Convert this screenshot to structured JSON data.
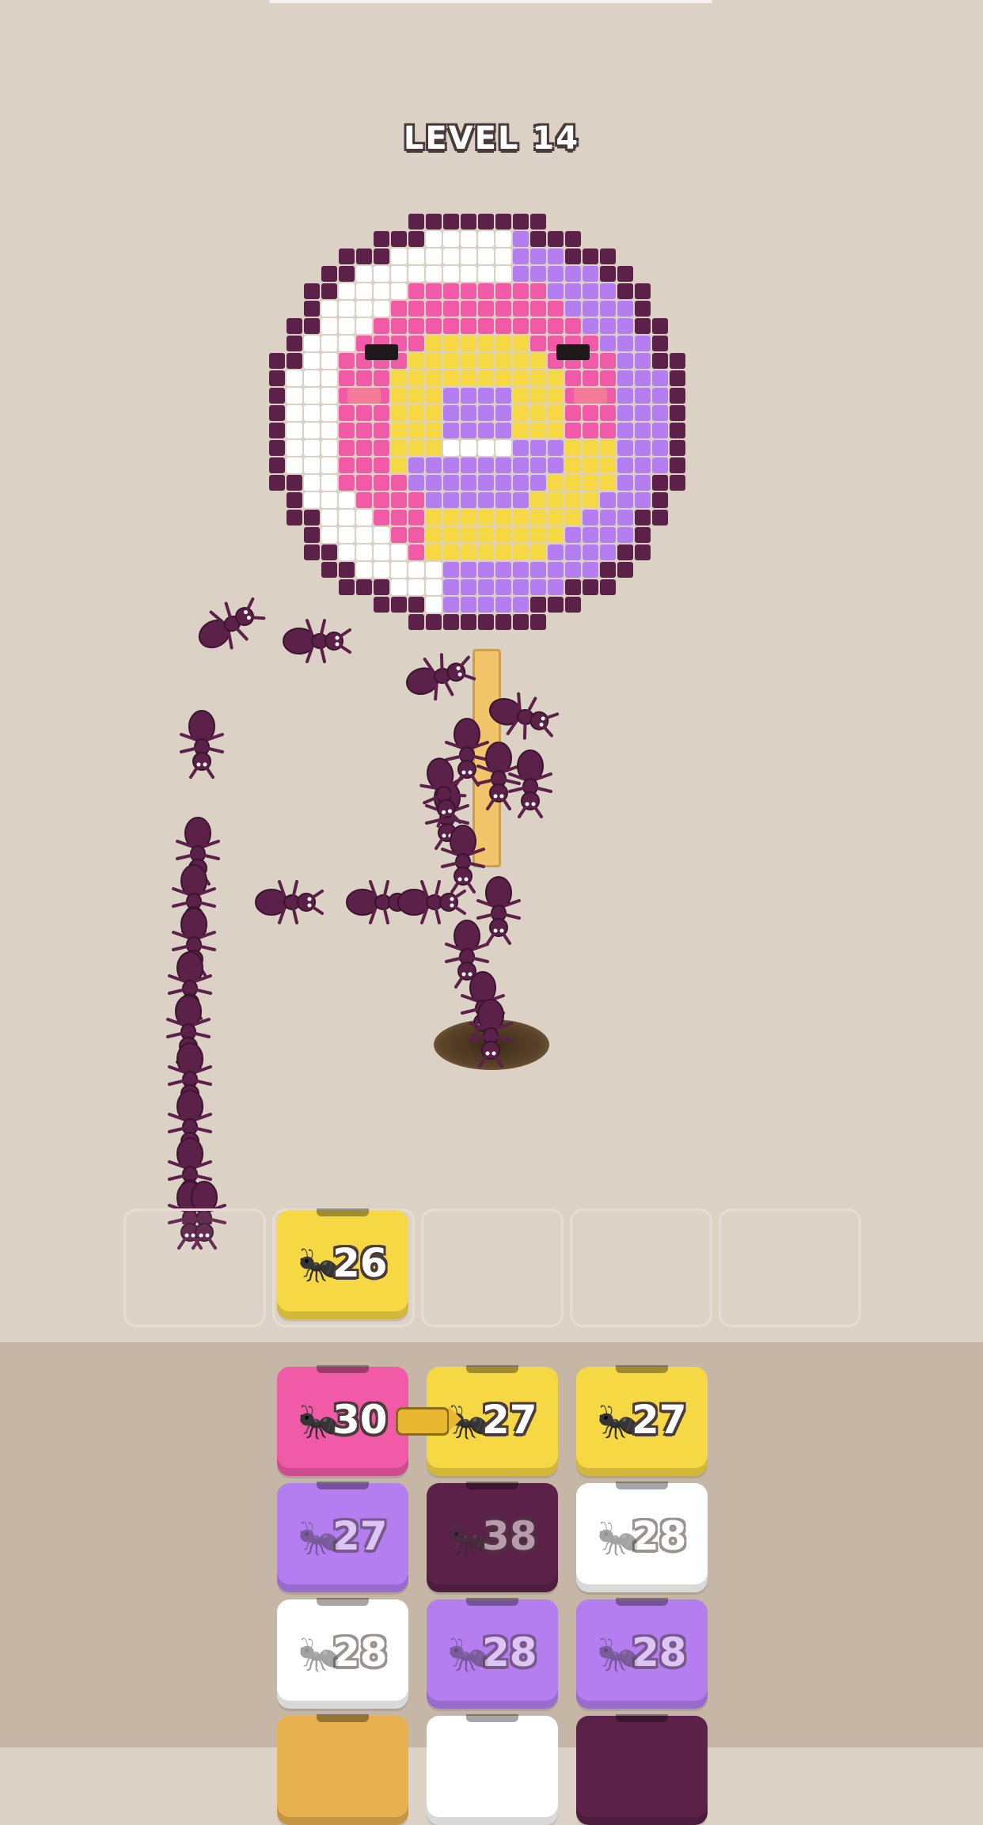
{
  "hud": {
    "level_label": "LEVEL 14"
  },
  "board": {
    "subject": "lollipop pixel art",
    "palette": {
      "outline": "#5c2148",
      "lavender": "#b47ef0",
      "white": "#ffffff",
      "pink": "#f05aa6",
      "yellow": "#f6d845",
      "blush": "#f47a9a",
      "eye": "#1e1a1c"
    },
    "ant_color": "#5c2148",
    "hole_icon": "hole-icon"
  },
  "slots": [
    {
      "state": "empty"
    },
    {
      "state": "filled",
      "color": "#f6d845",
      "count": "26",
      "icon": "ant-icon"
    },
    {
      "state": "empty"
    },
    {
      "state": "empty"
    },
    {
      "state": "empty"
    }
  ],
  "grid": [
    {
      "color": "#f05aa6",
      "count": "30",
      "icon": "ant-icon",
      "active": true
    },
    {
      "color": "#f6d845",
      "count": "27",
      "icon": "ant-icon",
      "active": true
    },
    {
      "color": "#f6d845",
      "count": "27",
      "icon": "ant-icon",
      "active": true
    },
    {
      "color": "#b47ef0",
      "count": "27",
      "icon": "ant-icon",
      "active": false
    },
    {
      "color": "#5c2148",
      "count": "38",
      "icon": "ant-icon",
      "active": false
    },
    {
      "color": "#ffffff",
      "count": "28",
      "icon": "ant-icon",
      "active": false
    },
    {
      "color": "#ffffff",
      "count": "28",
      "icon": "ant-icon",
      "active": false
    },
    {
      "color": "#b47ef0",
      "count": "28",
      "icon": "ant-icon",
      "active": false
    },
    {
      "color": "#b47ef0",
      "count": "28",
      "icon": "ant-icon",
      "active": false
    },
    {
      "color": "#e6b14e",
      "count": "",
      "icon": "",
      "active": false
    },
    {
      "color": "#ffffff",
      "count": "",
      "icon": "",
      "active": false
    },
    {
      "color": "#5c2148",
      "count": "",
      "icon": "",
      "active": false
    }
  ]
}
